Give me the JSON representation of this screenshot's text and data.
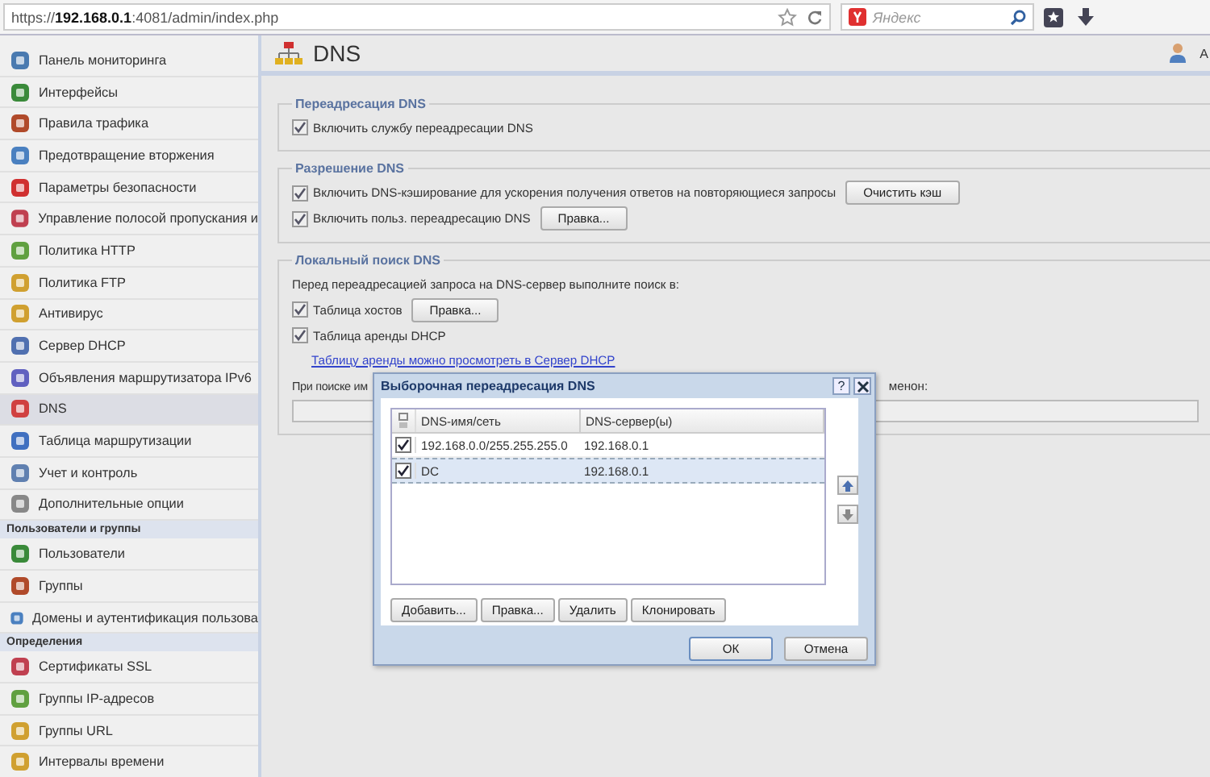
{
  "browser": {
    "url_host": "192.168.0.1",
    "url_prefix": "https://",
    "url_rest": ":4081/admin/index.php",
    "search_placeholder": "Яндекс"
  },
  "sidebar": {
    "items": [
      {
        "kind": "item",
        "label": "Панель мониторинга",
        "selected": false
      },
      {
        "kind": "item",
        "label": "Интерфейсы",
        "selected": false
      },
      {
        "kind": "item",
        "label": "Правила трафика",
        "selected": false
      },
      {
        "kind": "item",
        "label": "Предотвращение вторжения",
        "selected": false
      },
      {
        "kind": "item",
        "label": "Параметры безопасности",
        "selected": false
      },
      {
        "kind": "item",
        "label": "Управление полосой пропускания и",
        "selected": false
      },
      {
        "kind": "item",
        "label": "Политика HTTP",
        "selected": false
      },
      {
        "kind": "item",
        "label": "Политика FTP",
        "selected": false
      },
      {
        "kind": "item",
        "label": "Антивирус",
        "selected": false
      },
      {
        "kind": "item",
        "label": "Сервер DHCP",
        "selected": false
      },
      {
        "kind": "item",
        "label": "Объявления маршрутизатора IPv6",
        "selected": false
      },
      {
        "kind": "item",
        "label": "DNS",
        "selected": true
      },
      {
        "kind": "item",
        "label": "Таблица маршрутизации",
        "selected": false
      },
      {
        "kind": "item",
        "label": "Учет и контроль",
        "selected": false
      },
      {
        "kind": "item",
        "label": "Дополнительные опции",
        "selected": false
      },
      {
        "kind": "header",
        "label": "Пользователи и группы"
      },
      {
        "kind": "item",
        "label": "Пользователи",
        "selected": false
      },
      {
        "kind": "item",
        "label": "Группы",
        "selected": false
      },
      {
        "kind": "item",
        "label": "Домены и аутентификация пользова",
        "selected": false
      },
      {
        "kind": "header",
        "label": "Определения"
      },
      {
        "kind": "item",
        "label": "Сертификаты SSL",
        "selected": false
      },
      {
        "kind": "item",
        "label": "Группы IP-адресов",
        "selected": false
      },
      {
        "kind": "item",
        "label": "Группы URL",
        "selected": false
      },
      {
        "kind": "item",
        "label": "Интервалы времени",
        "selected": false
      }
    ]
  },
  "page": {
    "title": "DNS",
    "user_initial": "А"
  },
  "sections": [
    {
      "title": "Переадресация DNS",
      "rows": [
        {
          "kind": "checkbox",
          "label": "Включить службу переадресации DNS",
          "checked": true
        }
      ]
    },
    {
      "title": "Разрешение DNS",
      "rows": [
        {
          "kind": "checkbox",
          "label": "Включить DNS-кэширование для ускорения получения ответов на повторяющиеся запросы",
          "checked": true,
          "button": "Очистить кэш"
        },
        {
          "kind": "checkbox",
          "label": "Включить польз. переадресацию DNS",
          "checked": true,
          "button": "Правка..."
        }
      ]
    },
    {
      "title": "Локальный поиск DNS",
      "rows": [
        {
          "kind": "text",
          "label": "Перед переадресацией запроса на DNS-сервер выполните поиск в:"
        },
        {
          "kind": "checkbox",
          "label": "Таблица хостов",
          "checked": true,
          "button": "Правка..."
        },
        {
          "kind": "checkbox",
          "label": "Таблица аренды DHCP",
          "checked": true
        },
        {
          "kind": "link",
          "label": "Таблицу аренды можно просмотреть в Сервер DHCP"
        },
        {
          "kind": "split",
          "label": "При поиске им",
          "label_right": "менон:"
        },
        {
          "kind": "field"
        }
      ]
    }
  ],
  "dialog": {
    "title": "Выборочная переадресация DNS",
    "help": "?",
    "columns": [
      "DNS-имя/сеть",
      "DNS-сервер(ы)"
    ],
    "rows": [
      {
        "name": "192.168.0.0/255.255.255.0",
        "server": "192.168.0.1",
        "checked": true,
        "selected": false
      },
      {
        "name": "DC",
        "server": "192.168.0.1",
        "checked": true,
        "selected": true
      }
    ],
    "buttons": [
      "Добавить...",
      "Правка...",
      "Удалить",
      "Клонировать"
    ],
    "ok": "ОК",
    "cancel": "Отмена"
  }
}
